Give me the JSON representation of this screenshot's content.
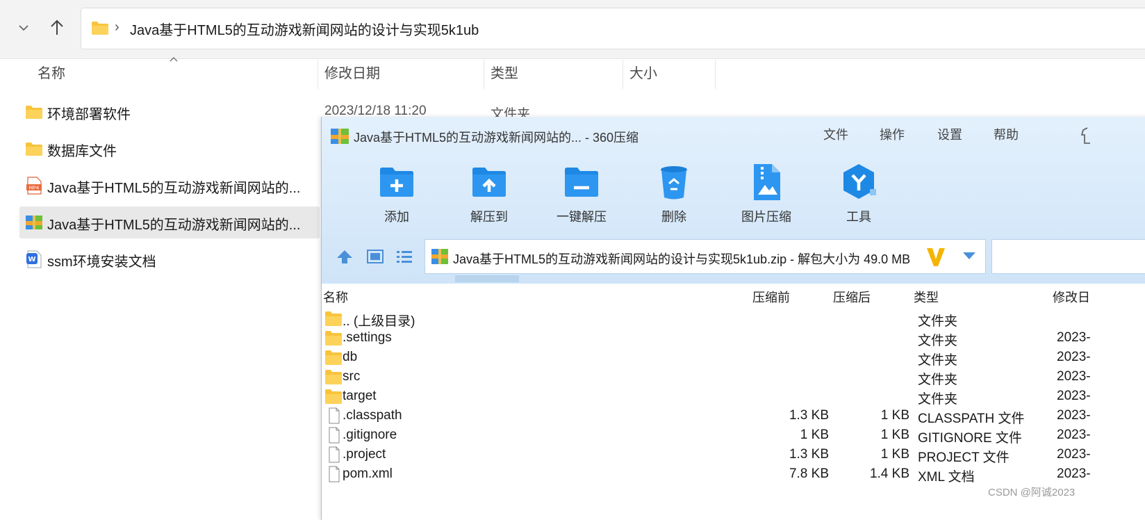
{
  "explorer": {
    "path": "Java基于HTML5的互动游戏新闻网站的设计与实现5k1ub",
    "columns": {
      "name": "名称",
      "date": "修改日期",
      "type": "类型",
      "size": "大小"
    },
    "rows": [
      {
        "name": "环境部署软件",
        "icon": "folder-icon"
      },
      {
        "name": "数据库文件",
        "icon": "folder-icon"
      },
      {
        "name": "Java基于HTML5的互动游戏新闻网站的...",
        "icon": "mp4-file-icon"
      },
      {
        "name": "Java基于HTML5的互动游戏新闻网站的...",
        "icon": "zip-archive-icon"
      },
      {
        "name": "ssm环境安装文档",
        "icon": "wps-doc-icon"
      }
    ],
    "first_row_date": "2023/12/18 11:20",
    "first_row_type": "文件夹"
  },
  "zip": {
    "title": "Java基于HTML5的互动游戏新闻网站的... - 360压缩",
    "menu": [
      "文件",
      "操作",
      "设置",
      "帮助"
    ],
    "tools": [
      "添加",
      "解压到",
      "一键解压",
      "删除",
      "图片压缩",
      "工具"
    ],
    "path": "Java基于HTML5的互动游戏新闻网站的设计与实现5k1ub.zip - 解包大小为 49.0 MB",
    "columns": {
      "name": "名称",
      "before": "压缩前",
      "after": "压缩后",
      "type": "类型",
      "date": "修改日"
    },
    "rows": [
      {
        "name": ".. (上级目录)",
        "before": "",
        "after": "",
        "type": "文件夹",
        "date": "",
        "kind": "folder"
      },
      {
        "name": ".settings",
        "before": "",
        "after": "",
        "type": "文件夹",
        "date": "2023-",
        "kind": "folder"
      },
      {
        "name": "db",
        "before": "",
        "after": "",
        "type": "文件夹",
        "date": "2023-",
        "kind": "folder"
      },
      {
        "name": "src",
        "before": "",
        "after": "",
        "type": "文件夹",
        "date": "2023-",
        "kind": "folder"
      },
      {
        "name": "target",
        "before": "",
        "after": "",
        "type": "文件夹",
        "date": "2023-",
        "kind": "folder"
      },
      {
        "name": ".classpath",
        "before": "1.3 KB",
        "after": "1 KB",
        "type": "CLASSPATH 文件",
        "date": "2023-",
        "kind": "file"
      },
      {
        "name": ".gitignore",
        "before": "1 KB",
        "after": "1 KB",
        "type": "GITIGNORE 文件",
        "date": "2023-",
        "kind": "file"
      },
      {
        "name": ".project",
        "before": "1.3 KB",
        "after": "1 KB",
        "type": "PROJECT 文件",
        "date": "2023-",
        "kind": "file"
      },
      {
        "name": "pom.xml",
        "before": "7.8 KB",
        "after": "1.4 KB",
        "type": "XML 文档",
        "date": "2023-",
        "kind": "file"
      }
    ]
  },
  "watermark": "CSDN @阿诚2023",
  "colors": {
    "accent": "#1e88e5",
    "panel": "#d6e9fa",
    "folder": "#f8c43c",
    "selection": "#e8e8e8"
  }
}
